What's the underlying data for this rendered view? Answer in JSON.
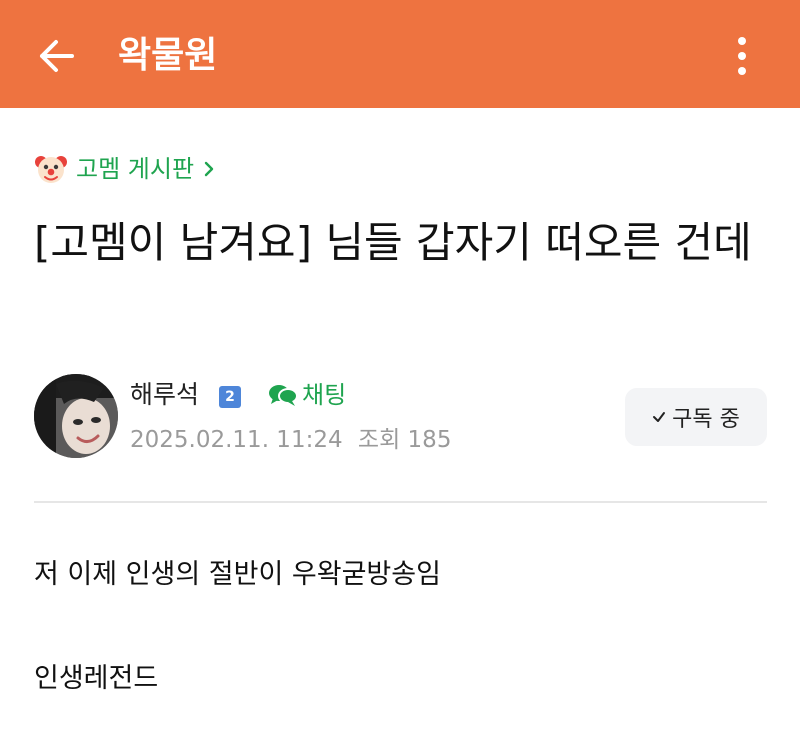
{
  "appbar": {
    "title": "왁물원",
    "back_icon": "arrow-left-icon",
    "more_icon": "more-vertical-icon",
    "color": "#ee7340"
  },
  "board": {
    "label": "고멤 게시판",
    "emoji_icon": "clown-face-icon",
    "chevron_icon": "chevron-right-icon",
    "color": "#1fa44f"
  },
  "post": {
    "title": "[고멤이 남겨요] 님들 갑자기 떠오른 건데",
    "author": "해루석",
    "level_badge": "2",
    "chat_label": "채팅",
    "date": "2025.02.11. 11:24",
    "views_label": "조회",
    "views": "185",
    "subscribe_label": "구독 중",
    "body": [
      "저 이제 인생의 절반이 우왁굳방송임",
      "인생레전드"
    ]
  }
}
